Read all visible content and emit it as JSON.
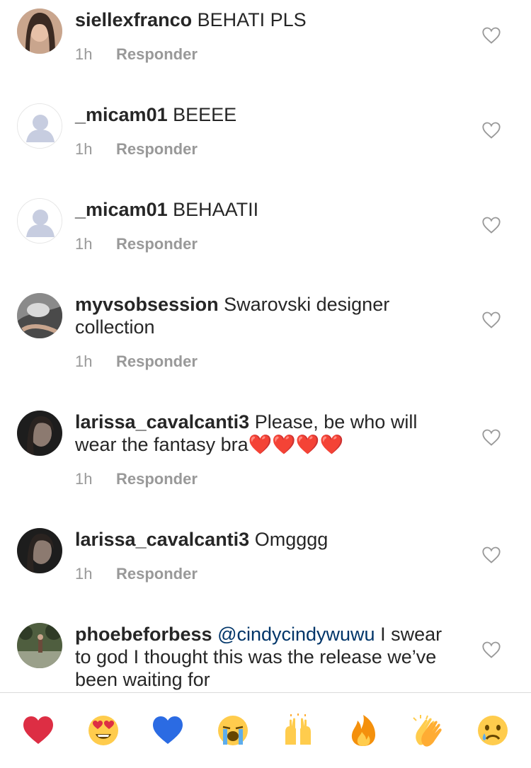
{
  "comments": [
    {
      "username": "siellexfranco",
      "text": " BEHATI PLS",
      "time": "1h",
      "reply": "Responder",
      "avatar": "photo"
    },
    {
      "username": "_micam01",
      "text": " BEEEE",
      "time": "1h",
      "reply": "Responder",
      "avatar": "default"
    },
    {
      "username": "_micam01",
      "text": " BEHAATII",
      "time": "1h",
      "reply": "Responder",
      "avatar": "default"
    },
    {
      "username": "myvsobsession",
      "text": " Swarovski designer collection",
      "time": "1h",
      "reply": "Responder",
      "avatar": "photo"
    },
    {
      "username": "larissa_cavalcanti3",
      "text": " Please, be who will wear the fantasy bra❤️❤️❤️❤️",
      "time": "1h",
      "reply": "Responder",
      "avatar": "photo"
    },
    {
      "username": "larissa_cavalcanti3",
      "text": " Omgggg",
      "time": "1h",
      "reply": "Responder",
      "avatar": "photo"
    },
    {
      "username": "phoebeforbess",
      "mention": "@cindycindywuwu",
      "text": " I swear to god I thought this was the release we’ve been waiting for",
      "avatar": "photo"
    }
  ],
  "emoji_bar": [
    {
      "name": "red-heart",
      "glyph": "❤️"
    },
    {
      "name": "heart-eyes",
      "glyph": "😍"
    },
    {
      "name": "blue-heart",
      "glyph": "💙"
    },
    {
      "name": "loudly-crying",
      "glyph": "😭"
    },
    {
      "name": "raising-hands",
      "glyph": "🙌"
    },
    {
      "name": "fire",
      "glyph": "🔥"
    },
    {
      "name": "clapping-hands",
      "glyph": "👏"
    },
    {
      "name": "crying-face",
      "glyph": "😢"
    }
  ],
  "colors": {
    "text": "#262626",
    "meta": "#999999",
    "mention": "#003569",
    "divider": "#dbdbdb"
  }
}
